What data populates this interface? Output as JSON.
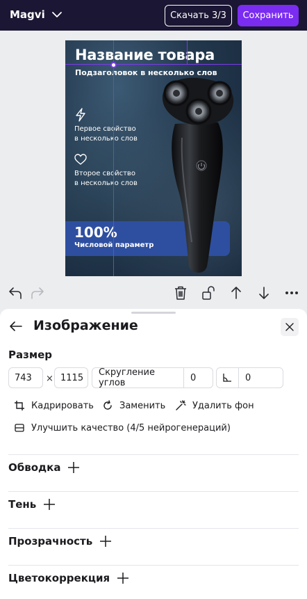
{
  "header": {
    "brand": "Magvi",
    "download_label": "Скачать 3/3",
    "save_label": "Сохранить",
    "colors": {
      "bar": "#1a1633",
      "save": "#7a2cf0"
    }
  },
  "product_card": {
    "title": "Название товара",
    "subtitle": "Подзаголовок в несколько слов",
    "feature1_icon": "lightning-icon",
    "feature1_line1": "Первое свойство",
    "feature1_line2": "в несколько слов",
    "feature2_icon": "heart-icon",
    "feature2_line1": "Второе свойство",
    "feature2_line2": "в несколько слов",
    "badge_value": "100%",
    "badge_label": "Числовой параметр",
    "image": "electric-shaver"
  },
  "canvas_toolbar": {
    "left": [
      "undo-icon",
      "redo-icon"
    ],
    "right": [
      "trash-icon",
      "unlock-icon",
      "arrow-up-icon",
      "arrow-down-icon",
      "more-icon"
    ]
  },
  "panel": {
    "title": "Изображение",
    "size_label": "Размер",
    "width_value": "743",
    "times_sign": "×",
    "height_value": "1115",
    "rounding_label": "Скругление углов",
    "rounding_value": "0",
    "angle_value": "0",
    "actions": {
      "crop": "Кадрировать",
      "replace": "Заменить",
      "remove_bg": "Удалить фон",
      "enhance": "Улучшить качество (4/5 нейрогенераций)"
    },
    "sections": {
      "stroke": "Обводка",
      "shadow": "Тень",
      "opacity": "Прозрачность",
      "color_correction": "Цветокоррекция"
    }
  }
}
